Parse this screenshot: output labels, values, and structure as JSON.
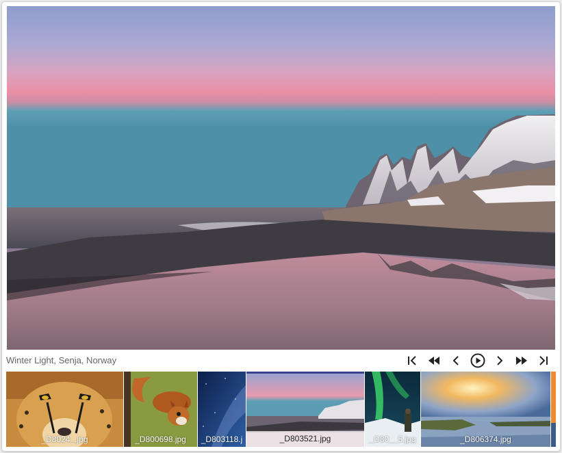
{
  "viewer": {
    "caption": "Winter Light, Senja, Norway",
    "main_image": "mountain-lake-sunset-photo"
  },
  "controls": {
    "first": "skip-to-first-icon",
    "rewind": "rewind-icon",
    "prev": "previous-icon",
    "play": "play-circle-icon",
    "next": "next-icon",
    "fast_forward": "fast-forward-icon",
    "last": "skip-to-last-icon"
  },
  "thumbnails": [
    {
      "label": "_D8024_.jpg",
      "subject": "cheetah"
    },
    {
      "label": "_D800698.jpg",
      "subject": "red-squirrel"
    },
    {
      "label": "_D803118.j",
      "subject": "night-sky"
    },
    {
      "label": "_D803521.jpg",
      "subject": "mountain-lake-sunset",
      "active": true
    },
    {
      "label": "_D80__5.jpg",
      "subject": "aurora-borealis"
    },
    {
      "label": "_D806374.jpg",
      "subject": "sunset-clouds-water"
    }
  ],
  "colors": {
    "active_border": "#3a3f8f",
    "caption_text": "#666666",
    "icon": "#222222"
  }
}
